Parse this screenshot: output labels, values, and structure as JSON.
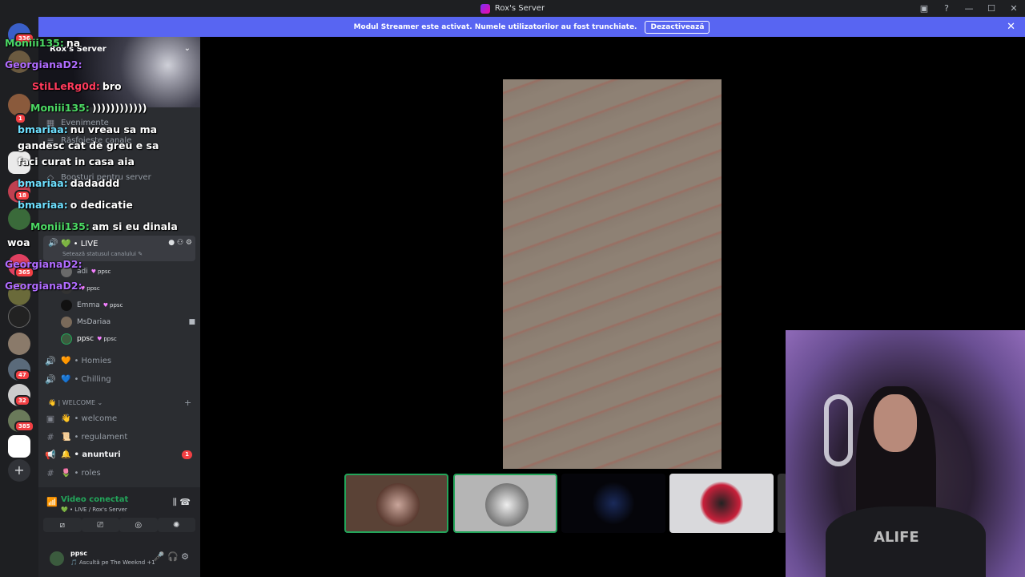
{
  "window": {
    "title": "Rox's Server"
  },
  "banner": {
    "text": "Modul Streamer este activat. Numele utilizatorilor au fost trunchiate.",
    "button": "Dezactivează",
    "close": "✕"
  },
  "guild_badges": [
    "336",
    "1",
    "18",
    "365",
    "47",
    "32",
    "385"
  ],
  "server": {
    "name": "Rox's Server"
  },
  "menu_items": [
    "Evenimente",
    "Răsfoiește canale",
    "Boosturi pentru server"
  ],
  "voice": {
    "live_label": "LIVE",
    "live_status": "Setează statusul canalului ✎",
    "users": [
      {
        "name": "adi",
        "tag": "ppsc"
      },
      {
        "name": "",
        "tag": "ppsc"
      },
      {
        "name": "Emma",
        "tag": "ppsc"
      },
      {
        "name": "MsDariaa",
        "tag": ""
      },
      {
        "name": "ppsc",
        "tag": "ppsc"
      }
    ],
    "other_channels": [
      {
        "label": "Homies",
        "emoji": "🧡"
      },
      {
        "label": "Chilling",
        "emoji": "💙"
      }
    ]
  },
  "category": {
    "label": "👋 | WELCOME ⌄",
    "add": "+"
  },
  "text_channels": [
    {
      "label": "welcome",
      "emoji": "👋",
      "icon": "▣"
    },
    {
      "label": "regulament",
      "emoji": "📜",
      "icon": "#"
    },
    {
      "label": "anunturi",
      "emoji": "🔔",
      "icon": "📢",
      "badge": "1"
    },
    {
      "label": "roles",
      "emoji": "🌷",
      "icon": "#"
    }
  ],
  "voice_connection": {
    "title": "Video conectat",
    "subtitle": "💚 • LIVE / Rox's Server"
  },
  "user_panel": {
    "name": "ppsc",
    "status": "🎵 Ascultă pe The Weeknd +1"
  },
  "chat_overlay": [
    {
      "user": "Moniii135:",
      "text": "na",
      "color": "#4cd964"
    },
    {
      "user": "GeorgianaD2:",
      "text": "",
      "color": "#b06cff"
    },
    {
      "user": "StiLLeRg0d:",
      "text": "bro",
      "color": "#ff3b5c"
    },
    {
      "user": "Moniii135:",
      "text": "))))))))))))",
      "color": "#4cd964"
    },
    {
      "user": "bmariaa:",
      "text": "nu vreau sa ma gandesc cat de greu e sa faci curat in casa aia",
      "color": "#6ee0ff"
    },
    {
      "user": "bmariaa:",
      "text": "dadaddd",
      "color": "#6ee0ff"
    },
    {
      "user": "bmariaa:",
      "text": "o dedicatie",
      "color": "#6ee0ff"
    },
    {
      "user": "Moniii135:",
      "text": "am si eu dinala",
      "color": "#4cd964"
    },
    {
      "user": "",
      "text": "woa",
      "color": "#ffffff"
    },
    {
      "user": "GeorgianaD2:",
      "text": "",
      "color": "#b06cff"
    },
    {
      "user": "GeorgianaD2:",
      "text": "",
      "color": "#b06cff"
    }
  ],
  "camera_shirt_text": "ALIFE",
  "colors": {
    "brand": "#5865f2",
    "green": "#23a55a",
    "red": "#f23f43"
  }
}
